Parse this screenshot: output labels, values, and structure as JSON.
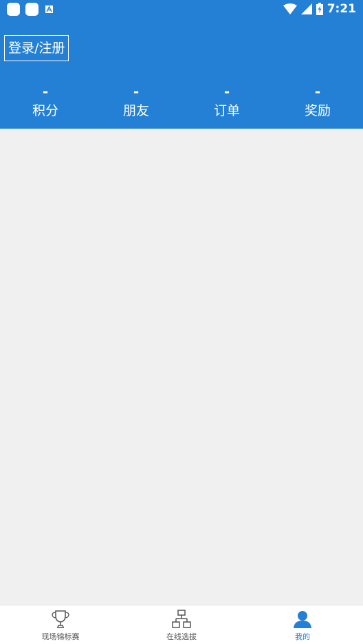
{
  "status_bar": {
    "time": "7:21",
    "notification_icons": [
      "app-icon",
      "app-icon",
      "font-a-icon"
    ],
    "system_icons": [
      "wifi-icon",
      "signal-icon",
      "battery-charging-icon"
    ]
  },
  "colors": {
    "primary": "#2380d5",
    "background": "#f0f0f0",
    "tab_inactive": "#555555"
  },
  "header": {
    "login_label": "登录/注册",
    "stats": [
      {
        "value": "-",
        "label": "积分"
      },
      {
        "value": "-",
        "label": "朋友"
      },
      {
        "value": "-",
        "label": "订单"
      },
      {
        "value": "-",
        "label": "奖励"
      }
    ]
  },
  "tabbar": {
    "tabs": [
      {
        "label": "现场锦标赛",
        "icon": "trophy-icon",
        "active": false
      },
      {
        "label": "在线选拔",
        "icon": "hierarchy-icon",
        "active": false
      },
      {
        "label": "我的",
        "icon": "person-icon",
        "active": true
      }
    ]
  }
}
